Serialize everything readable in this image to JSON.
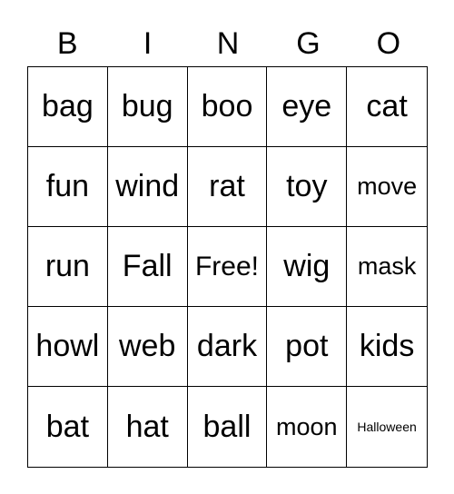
{
  "header": [
    "B",
    "I",
    "N",
    "G",
    "O"
  ],
  "cells": [
    "bag",
    "bug",
    "boo",
    "eye",
    "cat",
    "fun",
    "wind",
    "rat",
    "toy",
    "move",
    "run",
    "Fall",
    "Free!",
    "wig",
    "mask",
    "howl",
    "web",
    "dark",
    "pot",
    "kids",
    "bat",
    "hat",
    "ball",
    "moon",
    "Halloween"
  ]
}
